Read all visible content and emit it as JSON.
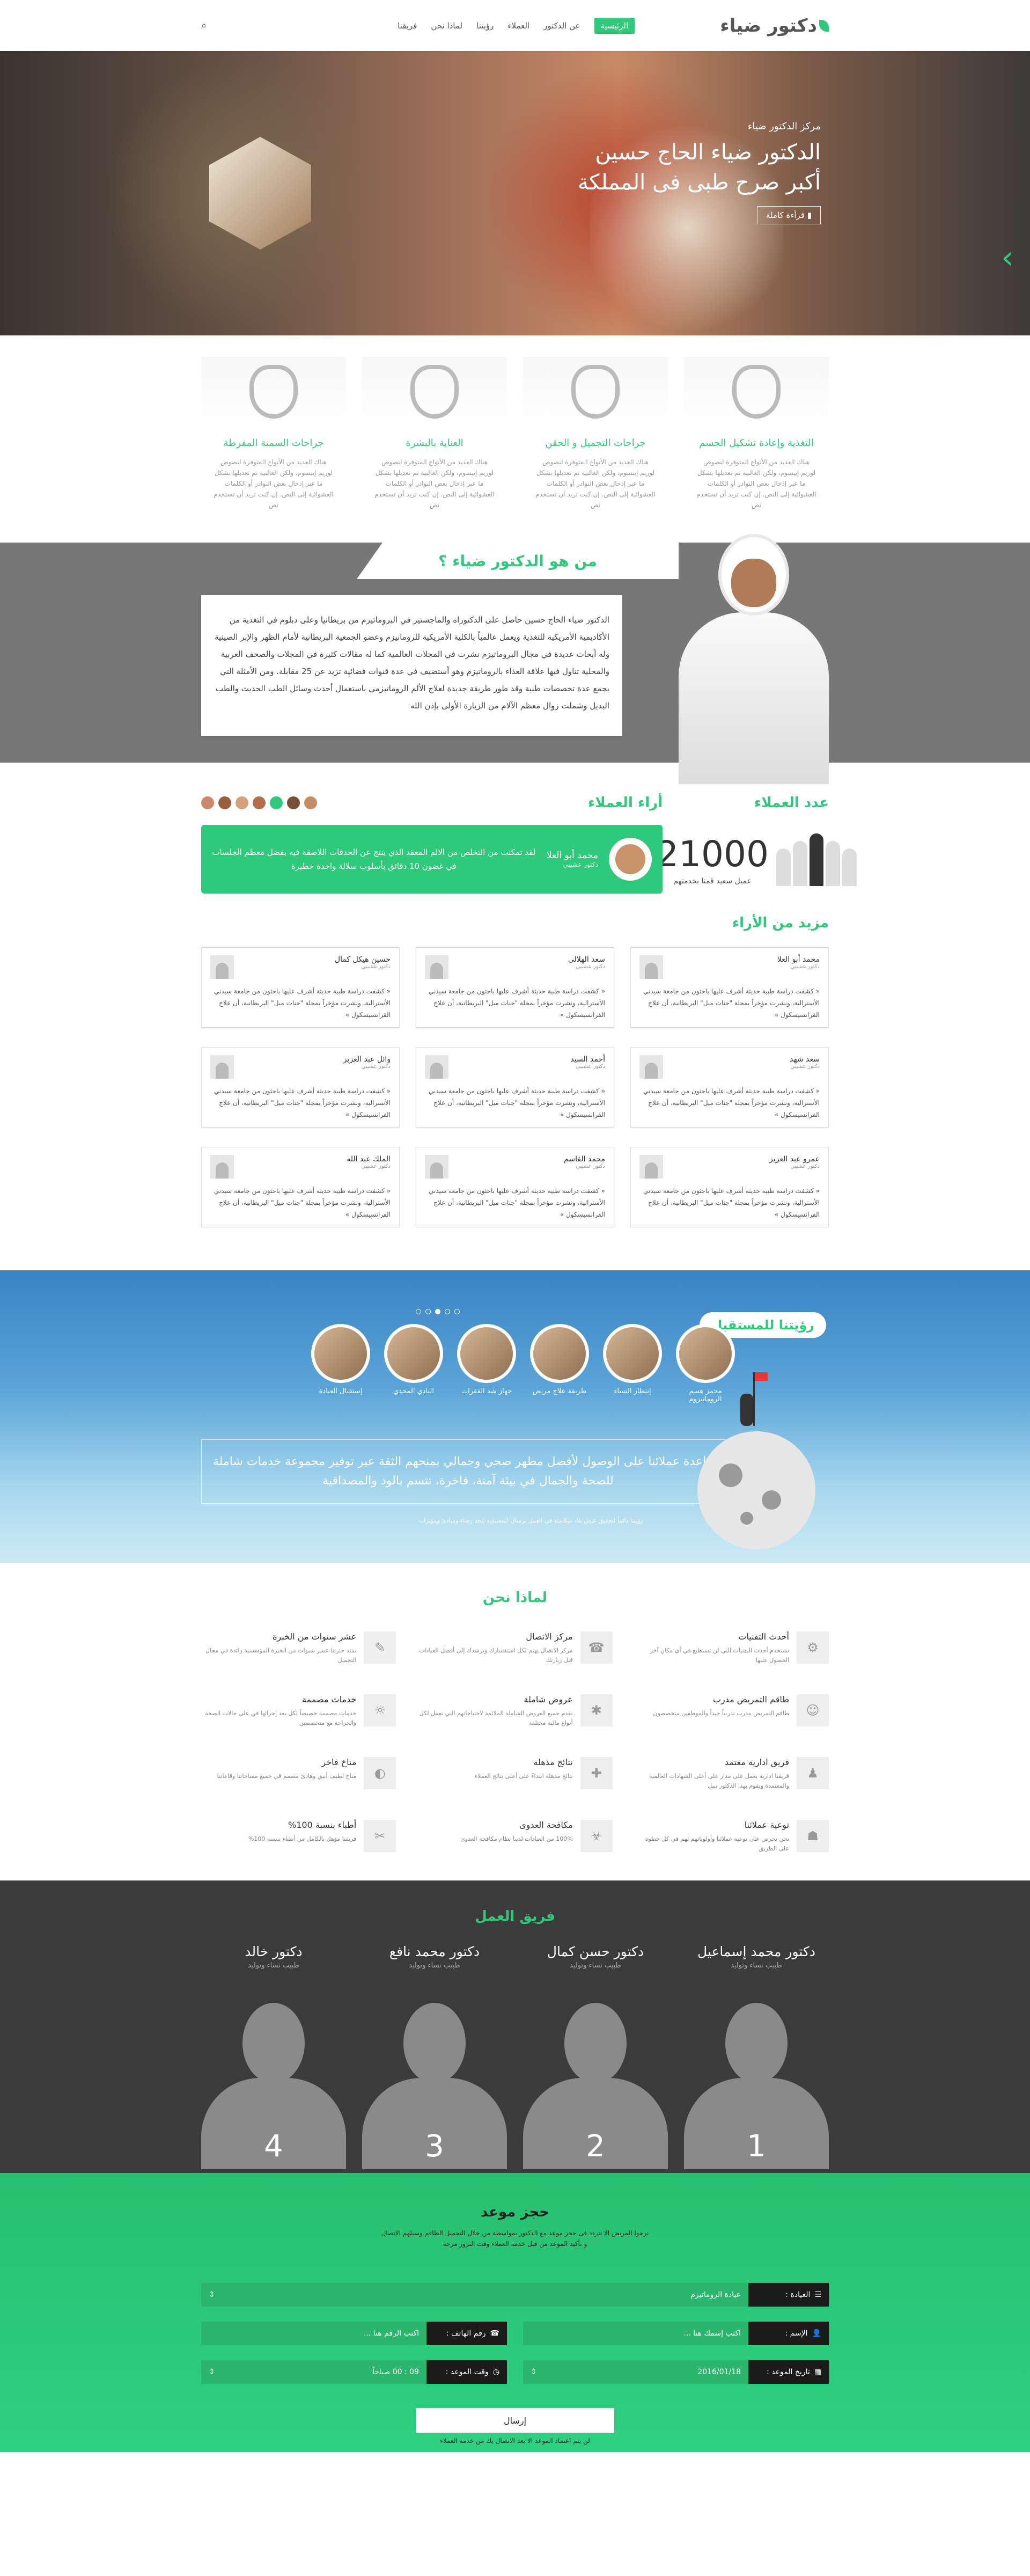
{
  "header": {
    "logo": "دكتور ضياء",
    "nav": [
      "الرئيسية",
      "عن الدكتور",
      "العملاء",
      "رؤيتنا",
      "لماذا نحن",
      "فريقنا"
    ]
  },
  "hero": {
    "sub": "مركز الدكتور ضياء",
    "title": "الدكتور ضياء الحاج حسين",
    "title2": "أكبر صرح طبى فى المملكة",
    "button": "قرأءة كاملة",
    "dots": 5,
    "active_dot": 3
  },
  "services": [
    {
      "title": "التغذية وإعادة تشكيل الجسم",
      "text": "هناك العديد من الأنواع المتوفرة لنصوص لوريم إيبسوم، ولكن الغالبية تم تعديلها بشكل ما عبر إدخال بعض النوادر أو الكلمات العشوائية إلى النص. إن كنت تريد أن تستخدم نص"
    },
    {
      "title": "جراحات التجميل و الحقن",
      "text": "هناك العديد من الأنواع المتوفرة لنصوص لوريم إيبسوم، ولكن الغالبية تم تعديلها بشكل ما عبر إدخال بعض النوادر أو الكلمات العشوائية إلى النص. إن كنت تريد أن تستخدم نص"
    },
    {
      "title": "العناية بالبشرة",
      "text": "هناك العديد من الأنواع المتوفرة لنصوص لوريم إيبسوم، ولكن الغالبية تم تعديلها بشكل ما عبر إدخال بعض النوادر أو الكلمات العشوائية إلى النص. إن كنت تريد أن تستخدم نص"
    },
    {
      "title": "جراحات السمنة المفرطة",
      "text": "هناك العديد من الأنواع المتوفرة لنصوص لوريم إيبسوم، ولكن الغالبية تم تعديلها بشكل ما عبر إدخال بعض النوادر أو الكلمات العشوائية إلى النص. إن كنت تريد أن تستخدم نص"
    }
  ],
  "about": {
    "title": "من هو الدكتور ضياء ؟",
    "text": "الدكتور ضياء الحاج حسين حاصل على الدكتوراه والماجستير في البروماتيزم من بريطانيا وعلى دبلوم في التغذية من الأكاديمية الأمريكية للتغذية ويعمل عالمياً بالكلية الأمريكية للرومانيزم وعضو الجمعية البريطانية لأمام الظهر والإبر الصينية وله أبحاث عديدة في مجال البروماتيزم نشرت في المجلات العالمية كما له مقالات كثيرة في المجلات والصحف العربية والمحلية تناول فيها علاقة الغذاء بالروماتيزم وهو أستضيف في عدة قنوات فضائية تزيد عن 25 مقابلة. ومن الأمثلة التي يجمع عدة تخصصات طبية وقد طور طريقة جديدة لعلاج الألم الروماتيزمي باستعمال أحدث وسائل الطب الحديث والطب البديل وشملت زوال معظم الآلام من الزيارة الأولى بإذن الله"
  },
  "clients": {
    "count_title": "عدد العملاء",
    "count": "21000",
    "count_sub": "عميل سعيد قمنا بخدمتهم",
    "testi_title": "أراء العملاء",
    "testi_name": "محمد أبو العلا",
    "testi_role": "دكتور عشيبي",
    "testi_quote": "لقد تمكنت من التخلص من الالم المعقد الذي ينتج عن الحدقات اللاصقة فيه بفضل معظم الجلسات في غضون 10 دقائق بأسلوب سلالة واحدة خطيرة",
    "avatar_colors": [
      "#c98a6b",
      "#9a5d3d",
      "#d3a27c",
      "#b16f4d",
      "#2ec97a",
      "#7a4f38",
      "#c58d66"
    ]
  },
  "more": {
    "title": "مزيد من الأراء",
    "reviews": [
      {
        "name": "محمد أبو العلا",
        "role": "دكتور عشيبي",
        "text": "« كشفت دراسة طبية حديثة أشرف عليها باحثون من جامعة سيدني الأسترالية، ونشرت مؤخراً بمجلة \"جنات ميل\" البريطانية، أن علاج الفرانسيسكول »"
      },
      {
        "name": "سعد الهلالى",
        "role": "دكتور عشيبي",
        "text": "« كشفت دراسة طبية حديثة أشرف عليها باحثون من جامعة سيدني الأسترالية، ونشرت مؤخراً بمجلة \"جنات ميل\" البريطانية، أن علاج الفرانسيسكول »"
      },
      {
        "name": "حسين هيكل كمال",
        "role": "دكتور عشيبي",
        "text": "« كشفت دراسة طبية حديثة أشرف عليها باحثون من جامعة سيدني الأسترالية، ونشرت مؤخراً بمجلة \"جنات ميل\" البريطانية، أن علاج الفرانسيسكول »"
      },
      {
        "name": "سعد شهد",
        "role": "دكتور عشيبي",
        "text": "« كشفت دراسة طبية حديثة أشرف عليها باحثون من جامعة سيدني الأسترالية، ونشرت مؤخراً بمجلة \"جنات ميل\" البريطانية، أن علاج الفرانسيسكول »"
      },
      {
        "name": "أحمد السيد",
        "role": "دكتور عشيبي",
        "text": "« كشفت دراسة طبية حديثة أشرف عليها باحثون من جامعة سيدني الأسترالية، ونشرت مؤخراً بمجلة \"جنات ميل\" البريطانية، أن علاج الفرانسيسكول »"
      },
      {
        "name": "وائل عبد العزيز",
        "role": "دكتور عشيبي",
        "text": "« كشفت دراسة طبية حديثة أشرف عليها باحثون من جامعة سيدني الأسترالية، ونشرت مؤخراً بمجلة \"جنات ميل\" البريطانية، أن علاج الفرانسيسكول »"
      },
      {
        "name": "عمرو عبد العزيز",
        "role": "دكتور عشيبي",
        "text": "« كشفت دراسة طبية حديثة أشرف عليها باحثون من جامعة سيدني الأسترالية، ونشرت مؤخراً بمجلة \"جنات ميل\" البريطانية، أن علاج الفرانسيسكول »"
      },
      {
        "name": "محمد القاسم",
        "role": "دكتور عشيبي",
        "text": "« كشفت دراسة طبية حديثة أشرف عليها باحثون من جامعة سيدني الأسترالية، ونشرت مؤخراً بمجلة \"جنات ميل\" البريطانية، أن علاج الفرانسيسكول »"
      },
      {
        "name": "الملك عبد الله",
        "role": "دكتور عشيبي",
        "text": "« كشفت دراسة طبية حديثة أشرف عليها باحثون من جامعة سيدني الأسترالية، ونشرت مؤخراً بمجلة \"جنات ميل\" البريطانية، أن علاج الفرانسيسكول »"
      }
    ]
  },
  "vision": {
    "title": "رؤيتنا للمستقبل",
    "items": [
      "مجمز هسم الروماتيزوم",
      "إنتظار النساء",
      "طريقة علاج مريض",
      "جهاز شد الفقرات",
      "النادي المجدي",
      "إستقبال العيادة"
    ],
    "text": "مساعدة عملائنا على الوصول لأفضل مظهر صحي وجمالي بمنحهم الثقة عبر توفير مجموعة خدمات شاملة للصحة والجمال في بيئة آمنة، فاخرة، تتسم بالود والمصداقية",
    "note": "رؤيتنا دائماً لتحقيق عيش بلاد متكاملة في العمل برسال المستفيد لتجد رضاء ومبادئ ومؤثرات"
  },
  "why": {
    "title": "لماذا نحن",
    "items": [
      {
        "title": "أحدث التقنيات",
        "text": "نستخدم أحدث التقنيات التي لن تستطيع في أي مكان آخر الحصول عليها"
      },
      {
        "title": "مركز الاتصال",
        "text": "مركز الاتصال يهتم لكل استفسارك ويرشدك إلى أفضل العيادات قبل زيارتك"
      },
      {
        "title": "عشر سنوات من الخبرة",
        "text": "تمتد خبرتنا عشر سنوات من الخبرة المؤسسية رائدة في مجال التجميل"
      },
      {
        "title": "طاقم التمريض مدرب",
        "text": "طاقم التمريض مدرب تدريباً جيداً والموظفين متخصصون"
      },
      {
        "title": "عروض شاملة",
        "text": "نقدم جميع العروض الشاملة الملائمة لاحتياجاتهم التي تعمل لكل أنواع مالية مختلفة"
      },
      {
        "title": "خدمات مصممة",
        "text": "خدمات مصممة خصيصاً لكل بعد إجرائها في على حالات الصحة والجراحة مع متخصصين"
      },
      {
        "title": "فريق ادارية معتمد",
        "text": "فريقنا ادارية يعمل على مدار على أعلى الشهادات العالمية والمعتمدة ويقوم بهذا الدكتور نبيل"
      },
      {
        "title": "نتائج مذهلة",
        "text": "نتائج مذهلة ابتداءً على أعلى نتائج العملاء"
      },
      {
        "title": "مناخ فاخر",
        "text": "مناخ لطيف أنيق وهادئ مصمم في جميع مساحاتنا وقاعاتنا"
      },
      {
        "title": "توعية عملائنا",
        "text": "نحن نحرص على توعية عملائنا وأولوياتهم لهم في كل خطوة على الطريق"
      },
      {
        "title": "مكافحة العدوى",
        "text": "100% من العيادات لدينا نظام مكافحة العدوى"
      },
      {
        "title": "أطباء بنسبة 100%",
        "text": "فريقنا مؤهل بالكامل من أطباء بنسبة 100%"
      }
    ]
  },
  "team": {
    "title": "فريق العمل",
    "members": [
      {
        "name": "دكتور محمد إسماعيل",
        "spec": "طبيب نساء وتوليد",
        "num": "1"
      },
      {
        "name": "دكتور حسن كمال",
        "spec": "طبيب نساء وتوليد",
        "num": "2"
      },
      {
        "name": "دكتور محمد نافع",
        "spec": "طبيب نساء وتوليد",
        "num": "3"
      },
      {
        "name": "دكتور خالد",
        "spec": "طبيب نساء وتوليد",
        "num": "4"
      }
    ]
  },
  "book": {
    "title": "حجز موعد",
    "desc1": "نرجوا المريض الا تتردد فى حجز موعد مع الدكتور بمواسطة من خلال التجميل الطاقم وسيلهم الاتصال",
    "desc2": "و تأكيد الموعد من قبل خدمة العملاء وقت التزور مرحة",
    "clinic_label": "العيادة :",
    "clinic_value": "عيادة الروماتيزم",
    "name_label": "الإسم :",
    "name_placeholder": "اكتب إسمك هنا ...",
    "phone_label": "رقم الهاتف :",
    "phone_placeholder": "اكتب الرقم هنا ...",
    "date_label": "تاريخ الموعد :",
    "date_value": "2016/01/18",
    "time_label": "وقت الموعد :",
    "time_value": "09 : 00 صباحاً",
    "send": "إرسال",
    "note": "لن يتم اعتماد الموعد الا بعد الاتصال بك من خدمة العملاء"
  }
}
